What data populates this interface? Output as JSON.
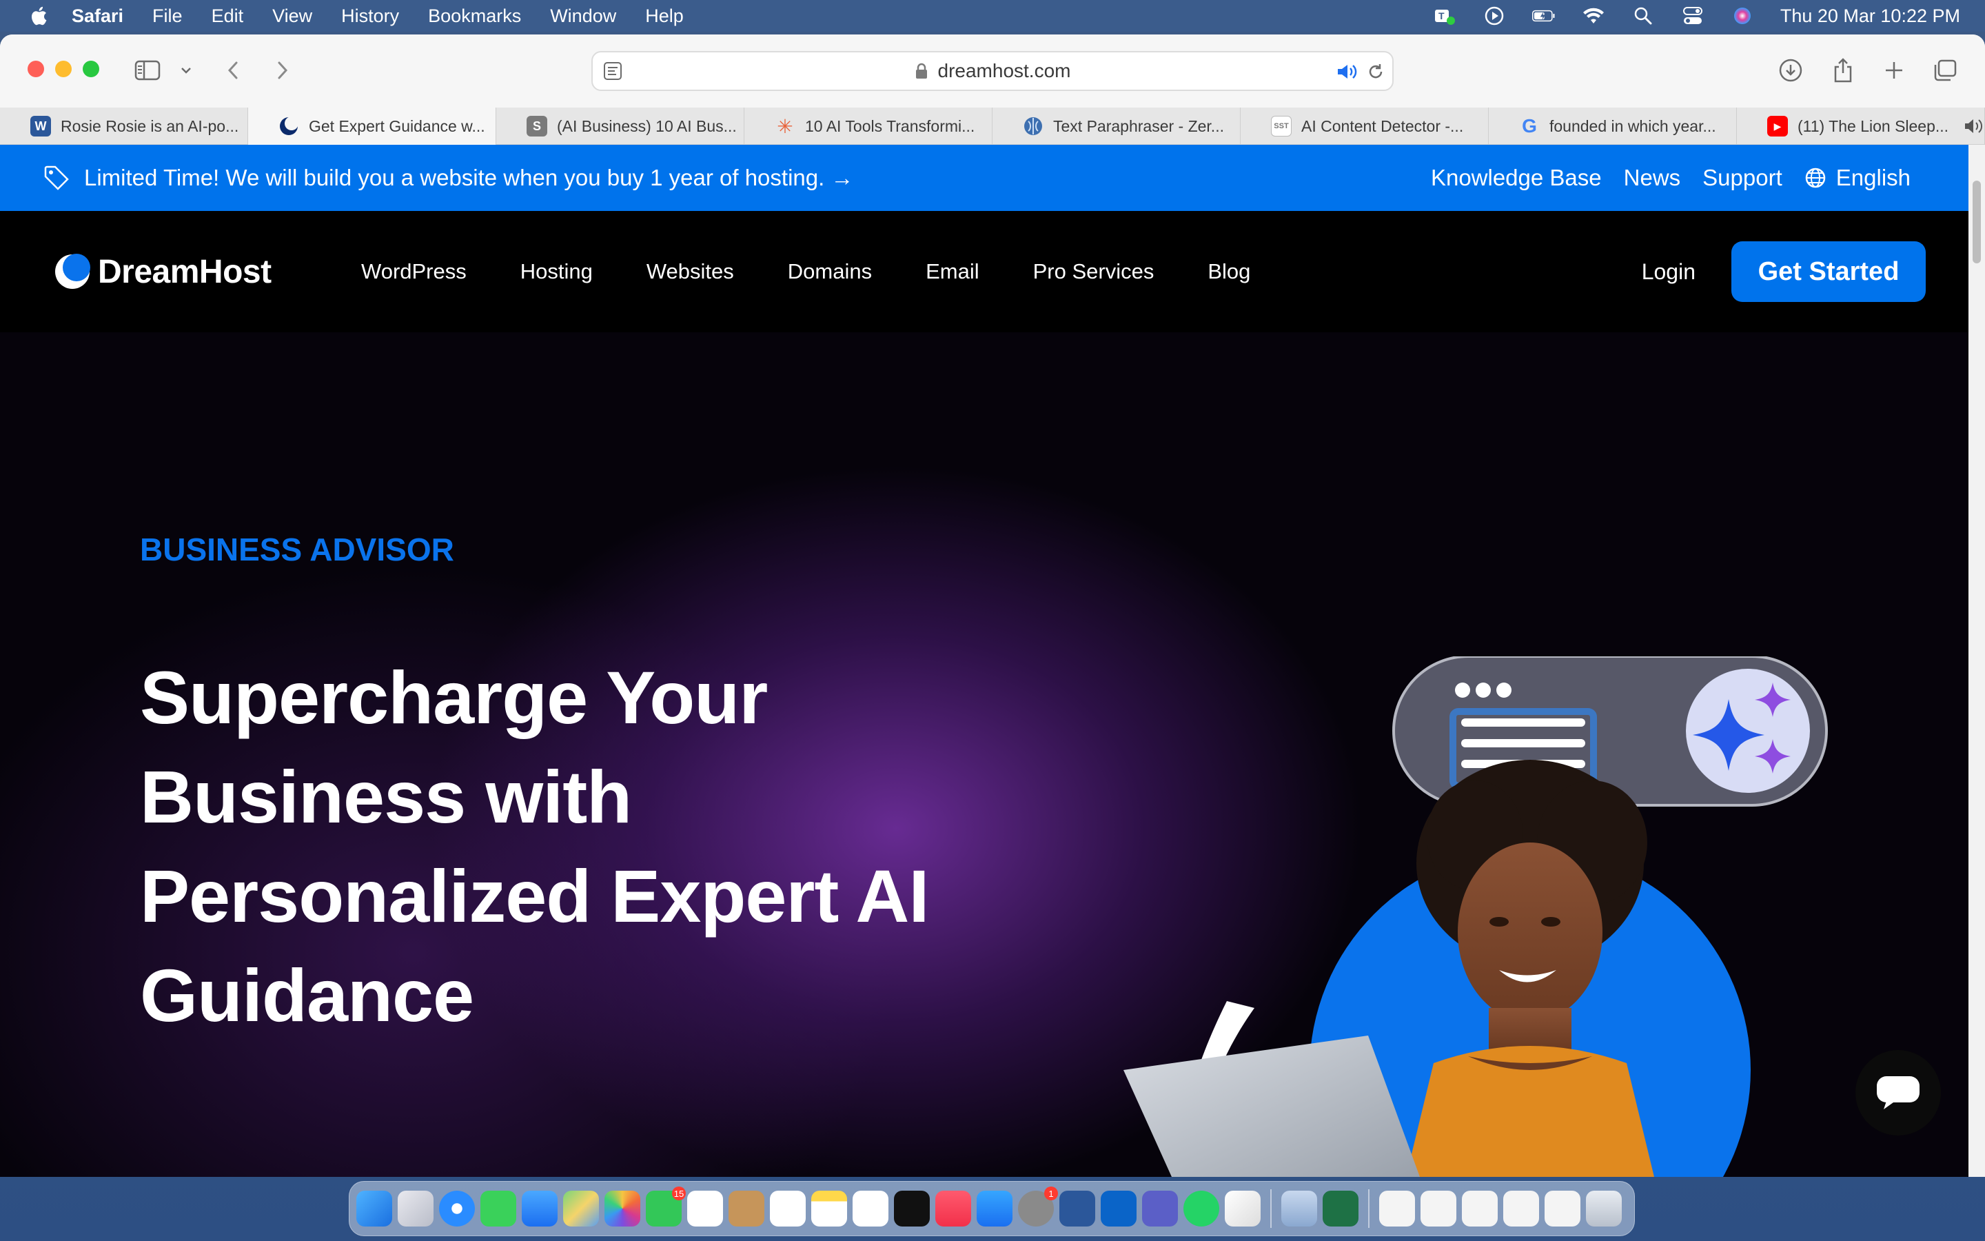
{
  "menubar": {
    "app_name": "Safari",
    "items": [
      "File",
      "Edit",
      "View",
      "History",
      "Bookmarks",
      "Window",
      "Help"
    ],
    "clock": "Thu 20 Mar  10:22 PM"
  },
  "browser": {
    "url": "dreamhost.com",
    "tabs": [
      {
        "label": "Rosie Rosie is an AI-po...",
        "favicon": "W",
        "color": "#2b579a"
      },
      {
        "label": "Get Expert Guidance w...",
        "favicon": "",
        "color": "#0073ec",
        "active": true
      },
      {
        "label": "(AI Business) 10 AI Bus...",
        "favicon": "S",
        "color": "#7a7a7a"
      },
      {
        "label": "10 AI Tools Transformi...",
        "favicon": "✳",
        "color": "#e8643c"
      },
      {
        "label": "Text Paraphraser - Zer...",
        "favicon": "",
        "color": "#3d6fb0"
      },
      {
        "label": "AI Content Detector -...",
        "favicon": "SST",
        "color": "#9a9a9a"
      },
      {
        "label": "founded in which year...",
        "favicon": "G",
        "color": "#4285f4"
      },
      {
        "label": "(11) The Lion Sleep...",
        "favicon": "▶",
        "color": "#ff0000"
      }
    ]
  },
  "promo": {
    "text": "Limited Time! We will build you a website when you buy 1 year of hosting.  →",
    "links": [
      "Knowledge Base",
      "News",
      "Support"
    ],
    "language": "English"
  },
  "nav": {
    "brand": "DreamHost",
    "items": [
      "WordPress",
      "Hosting",
      "Websites",
      "Domains",
      "Email",
      "Pro Services",
      "Blog"
    ],
    "login": "Login",
    "cta": "Get Started"
  },
  "hero": {
    "eyebrow": "BUSINESS ADVISOR",
    "headline": "Supercharge Your Business with Personalized Expert AI Guidance"
  },
  "colors": {
    "brand_blue": "#0073ec",
    "hero_bg": "#06030b",
    "purple_glow": "#7832aa"
  }
}
